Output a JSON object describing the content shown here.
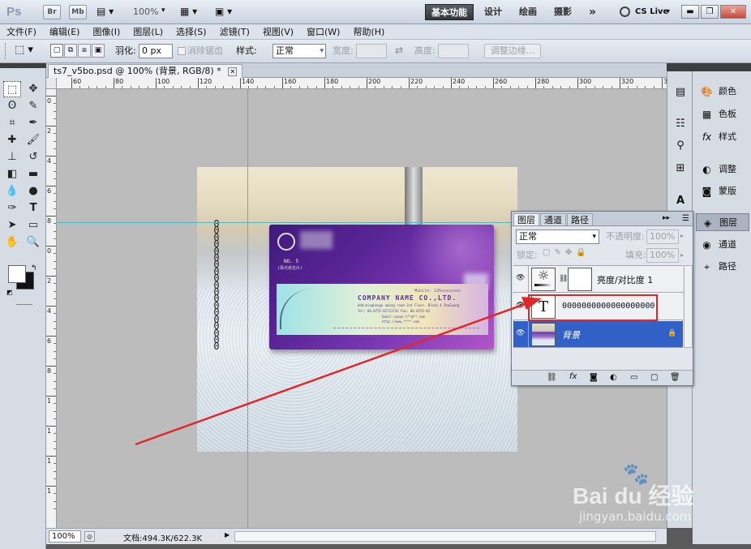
{
  "app": {
    "logo": "Ps",
    "bridge_label": "Br",
    "minibridge_label": "Mb",
    "zoom": "100%",
    "workspaces": [
      "基本功能",
      "设计",
      "绘画",
      "摄影"
    ],
    "more_label": "»",
    "cslive_label": "CS Live"
  },
  "menu": [
    "文件(F)",
    "编辑(E)",
    "图像(I)",
    "图层(L)",
    "选择(S)",
    "滤镜(T)",
    "视图(V)",
    "窗口(W)",
    "帮助(H)"
  ],
  "options": {
    "feather_label": "羽化:",
    "feather_value": "0 px",
    "antialias_label": "消除锯齿",
    "style_label": "样式:",
    "style_value": "正常",
    "width_label": "宽度:",
    "height_label": "高度:",
    "refine_edge_label": "调整边缘..."
  },
  "document": {
    "tab_title": "ts7_v5bo.psd @ 100% (背景, RGB/8) *",
    "ruler_top": [
      "60",
      "80",
      "100",
      "120",
      "140",
      "160",
      "180",
      "200",
      "220",
      "240",
      "260",
      "280",
      "300",
      "320",
      "340",
      "360",
      "380"
    ],
    "ruler_left": [
      "0",
      "2",
      "4",
      "6",
      "8",
      "0",
      "2",
      "4",
      "6",
      "8",
      "1",
      "1",
      "1",
      "1"
    ],
    "vertical_text": "0000000000000000000"
  },
  "card": {
    "no": "NO. 5",
    "subtitle": "(珠光纸名片)",
    "mobile": "Mobile: 135xxxxxxxx",
    "company": "COMPANY NAME CO.,LTD.",
    "addr": "Add:minghengu aming road 3rd Floor, Block 4 ZhuGuang",
    "tel": "Tel: 86-0755-82721733  Fax: 86-0755-82",
    "email": "Email:caoye.t**@**.com",
    "web": "http://www.****.com"
  },
  "status": {
    "zoom": "100%",
    "doc_size": "文档:494.3K/622.3K"
  },
  "layers_panel": {
    "tabs": [
      "图层",
      "通道",
      "路径"
    ],
    "blend_mode": "正常",
    "opacity_label": "不透明度:",
    "opacity_value": "100%",
    "lock_label": "锁定:",
    "fill_label": "填充:",
    "fill_value": "100%",
    "layers": [
      {
        "name": "亮度/对比度 1",
        "type": "adjustment",
        "selected": false
      },
      {
        "name": "0000000000000000000",
        "type": "text",
        "thumb_label": "T",
        "selected": false
      },
      {
        "name": "背景",
        "type": "background",
        "selected": true
      }
    ]
  },
  "dock": {
    "items": [
      "颜色",
      "色板",
      "样式",
      "调整",
      "蒙版",
      "图层",
      "通道",
      "路径"
    ],
    "active": "图层"
  },
  "watermark": {
    "brand": "Bai du 经验",
    "url": "jingyan.baidu.com"
  },
  "colors": {
    "guide": "#00d6e8",
    "selection_blue": "#3161c6",
    "highlight_red": "#e02828"
  }
}
